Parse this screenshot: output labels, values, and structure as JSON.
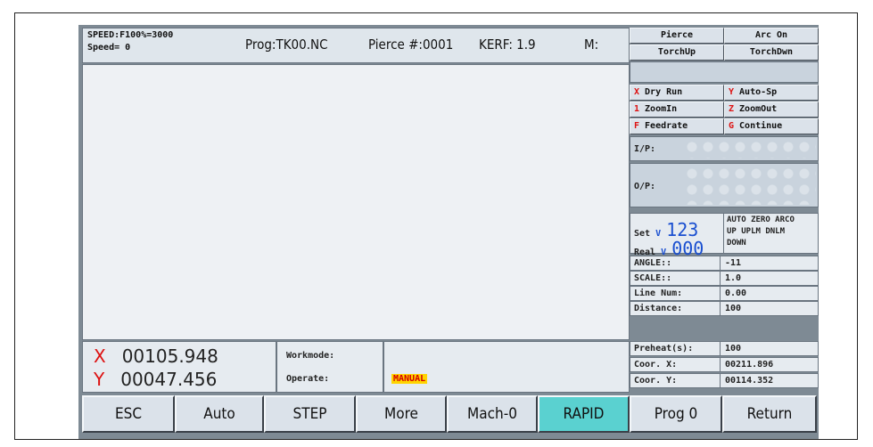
{
  "header": {
    "speed_override": "SPEED:F100%=3000",
    "speed_value": "Speed=  0",
    "program": "Prog:TK00.NC",
    "pierce": "Pierce #:0001",
    "kerf": "KERF: 1.9",
    "m_code": "M:"
  },
  "coords": {
    "x_axis": "X",
    "x_value": "00105.948",
    "y_axis": "Y",
    "y_value": "00047.456"
  },
  "mode": {
    "workmode_label": "Workmode:",
    "operate_label": "Operate:",
    "operate_value": "MANUAL"
  },
  "right_buttons": [
    {
      "key": "",
      "label": "Pierce"
    },
    {
      "key": "",
      "label": "Arc On"
    },
    {
      "key": "",
      "label": "TorchUp"
    },
    {
      "key": "",
      "label": "TorchDwn"
    },
    {
      "key": "X",
      "label": "Dry Run"
    },
    {
      "key": "Y",
      "label": "Auto-Sp"
    },
    {
      "key": "1",
      "label": "ZoomIn"
    },
    {
      "key": "Z",
      "label": "ZoomOut"
    },
    {
      "key": "F",
      "label": "Feedrate"
    },
    {
      "key": "G",
      "label": "Continue"
    }
  ],
  "io": {
    "input_label": "I/P:",
    "output_label": "O/P:"
  },
  "thc": {
    "set_label": "Set",
    "set_unit": "V",
    "set_value": "123",
    "real_label": "Real",
    "real_unit": "V",
    "real_value": "000",
    "flags_row1": "AUTO ZERO ARCO",
    "flags_row2": "UP    UPLM DNLM",
    "flags_row3": "DOWN"
  },
  "info": [
    {
      "label": "ANGLE::",
      "value": "-11"
    },
    {
      "label": "SCALE::",
      "value": "1.0"
    },
    {
      "label": "Line Num:",
      "value": "0.00"
    },
    {
      "label": "Distance:",
      "value": "100"
    },
    {
      "label": "Preheat(s):",
      "value": "100"
    },
    {
      "label": "Coor. X:",
      "value": "00211.896"
    },
    {
      "label": "Coor. Y:",
      "value": "00114.352"
    }
  ],
  "function_keys": [
    {
      "label": "ESC"
    },
    {
      "label": "Auto"
    },
    {
      "label": "STEP"
    },
    {
      "label": "More"
    },
    {
      "label": "Mach-0"
    },
    {
      "label": "RAPID",
      "active": true
    },
    {
      "label": "Prog 0"
    },
    {
      "label": "Return"
    }
  ],
  "colors": {
    "active_key": "#5ad1d0",
    "panel_bg": "#e6ebf0",
    "accent_red": "#d11111",
    "accent_blue": "#1a4fd0",
    "manual_highlight": "#ffd400"
  }
}
